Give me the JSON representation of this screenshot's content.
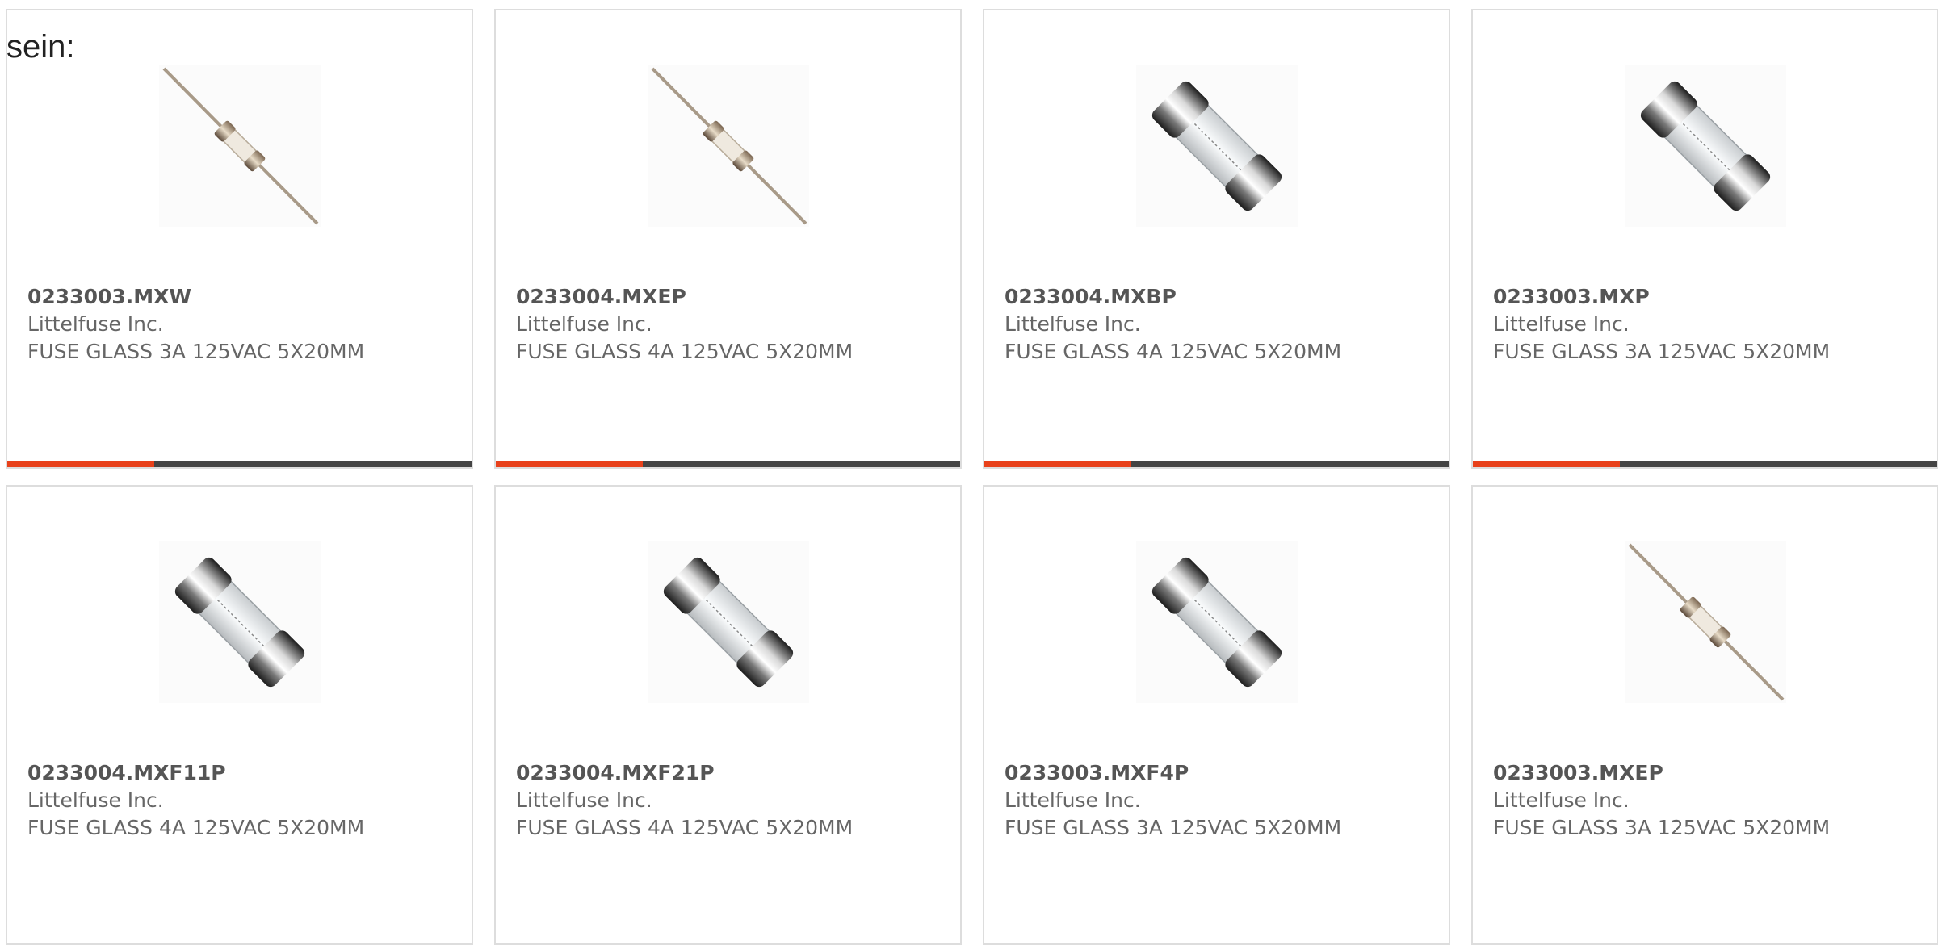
{
  "intro": "sein:",
  "colors": {
    "accent": "#e8411b",
    "bar": "#444444",
    "border": "#dddddd"
  },
  "products": [
    {
      "part": "0233003.MXW",
      "manufacturer": "Littelfuse Inc.",
      "description": "FUSE GLASS 3A 125VAC 5X20MM",
      "image": "axial-fuse",
      "bar": true
    },
    {
      "part": "0233004.MXEP",
      "manufacturer": "Littelfuse Inc.",
      "description": "FUSE GLASS 4A 125VAC 5X20MM",
      "image": "axial-fuse",
      "bar": true
    },
    {
      "part": "0233004.MXBP",
      "manufacturer": "Littelfuse Inc.",
      "description": "FUSE GLASS 4A 125VAC 5X20MM",
      "image": "cartridge-fuse",
      "bar": true
    },
    {
      "part": "0233003.MXP",
      "manufacturer": "Littelfuse Inc.",
      "description": "FUSE GLASS 3A 125VAC 5X20MM",
      "image": "cartridge-fuse",
      "bar": true
    },
    {
      "part": "0233004.MXF11P",
      "manufacturer": "Littelfuse Inc.",
      "description": "FUSE GLASS 4A 125VAC 5X20MM",
      "image": "cartridge-fuse",
      "bar": false
    },
    {
      "part": "0233004.MXF21P",
      "manufacturer": "Littelfuse Inc.",
      "description": "FUSE GLASS 4A 125VAC 5X20MM",
      "image": "cartridge-fuse",
      "bar": false
    },
    {
      "part": "0233003.MXF4P",
      "manufacturer": "Littelfuse Inc.",
      "description": "FUSE GLASS 3A 125VAC 5X20MM",
      "image": "cartridge-fuse",
      "bar": false
    },
    {
      "part": "0233003.MXEP",
      "manufacturer": "Littelfuse Inc.",
      "description": "FUSE GLASS 3A 125VAC 5X20MM",
      "image": "axial-fuse",
      "bar": false
    }
  ]
}
